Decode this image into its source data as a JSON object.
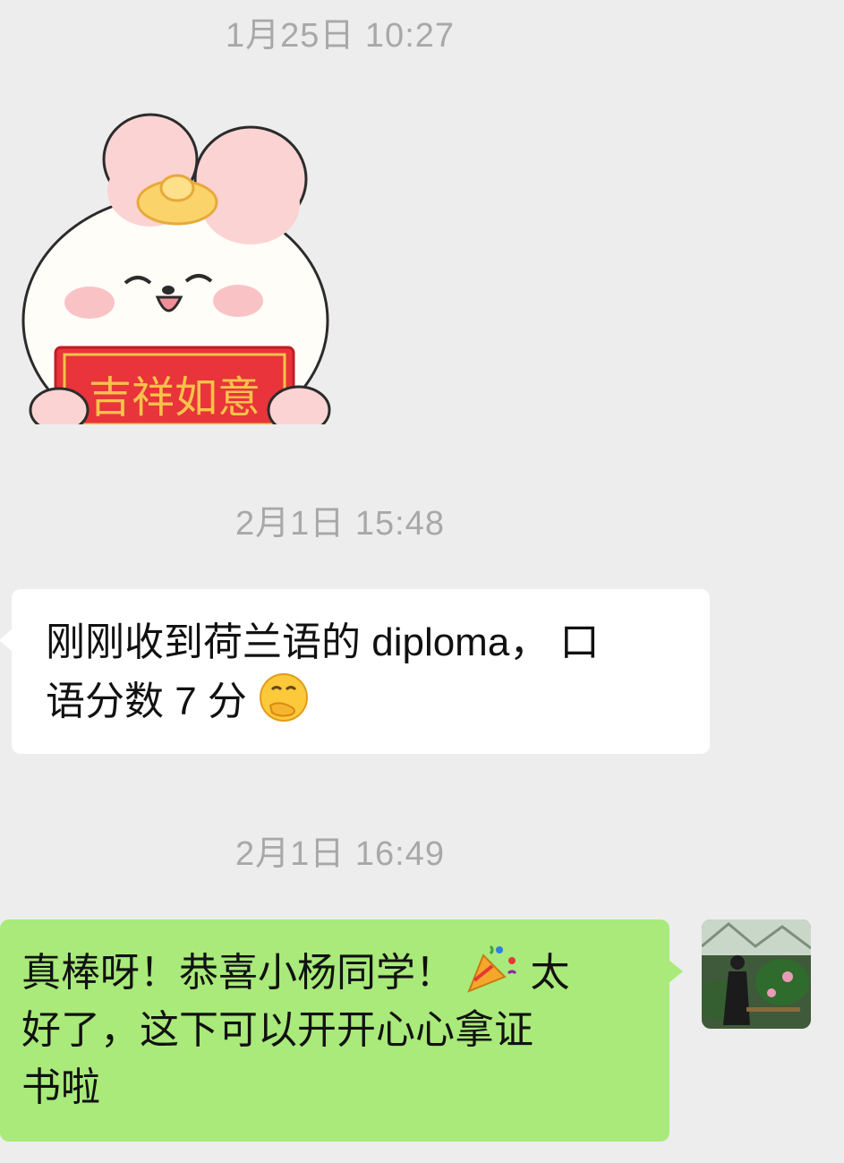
{
  "timestamps": [
    "1月25日 10:27",
    "2月1日 15:48",
    "2月1日 16:49"
  ],
  "sticker": {
    "banner_text": "吉祥如意",
    "icon": "bunny-sticker"
  },
  "messages": [
    {
      "side": "left",
      "text_part1": "刚刚收到荷兰语的 diploma， 口",
      "text_part2": "语分数 7 分",
      "emoji": "hand-over-mouth-emoji"
    },
    {
      "side": "right",
      "text_part1": "真棒呀！恭喜小杨同学！",
      "text_part2": "太",
      "text_part3": "好了，这下可以开开心心拿证",
      "text_part4": "书啦",
      "emoji": "party-popper-emoji"
    }
  ],
  "colors": {
    "background": "#ededed",
    "incoming_bubble": "#ffffff",
    "outgoing_bubble": "#a9ea7a",
    "timestamp": "#a8a8a8"
  }
}
